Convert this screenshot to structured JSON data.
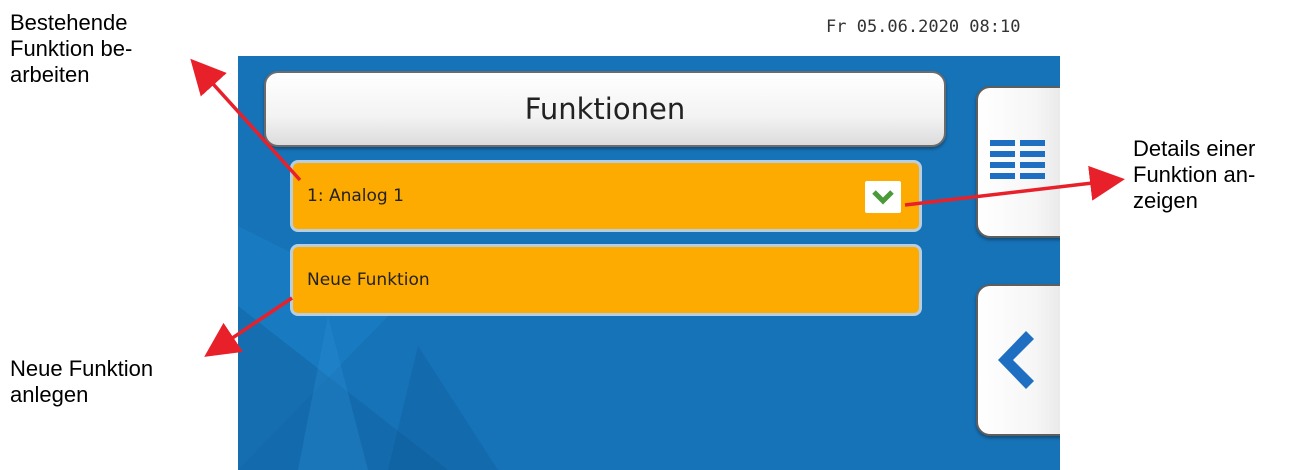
{
  "annotations": {
    "edit_existing": [
      "Bestehende",
      "Funktion  be-",
      "arbeiten"
    ],
    "new_function": [
      "Neue Funktion",
      "anlegen"
    ],
    "show_details": [
      "Details einer",
      "Funktion an-",
      "zeigen"
    ],
    "arrow_color": "#e8202a"
  },
  "status": {
    "datetime": "Fr 05.06.2020 08:10"
  },
  "screen": {
    "background_color": "#1673b8",
    "title": "Funktionen",
    "items": [
      {
        "label": "1: Analog 1",
        "has_details": true
      },
      {
        "label": "Neue Funktion",
        "has_details": false
      }
    ],
    "item_color": "#fdab00",
    "side_buttons": [
      {
        "icon": "list-icon"
      },
      {
        "icon": "back-chevron-icon"
      }
    ],
    "icon_blue": "#1e6fc2",
    "check_green": "#4a9a3a"
  }
}
